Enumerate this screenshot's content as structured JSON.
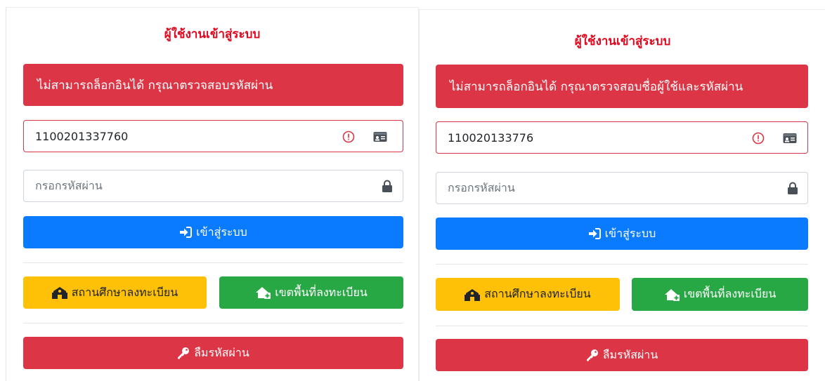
{
  "panels": [
    {
      "title": "ผู้ใช้งานเข้าสู่ระบบ",
      "alert": "ไม่สามารถล็อกอินได้ กรุณาตรวจสอบรหัสผ่าน",
      "username_value": "1100201337760",
      "password_placeholder": "กรอกรหัสผ่าน",
      "login_label": "เข้าสู่ระบบ",
      "school_label": "สถานศึกษาลงทะเบียน",
      "area_label": "เขตพื้นที่ลงทะเบียน",
      "forgot_label": "ลืมรหัสผ่าน"
    },
    {
      "title": "ผู้ใช้งานเข้าสู่ระบบ",
      "alert": "ไม่สามารถล็อกอินได้ กรุณาตรวจสอบชื่อผู้ใช้และรหัสผ่าน",
      "username_value": "110020133776",
      "password_placeholder": "กรอกรหัสผ่าน",
      "login_label": "เข้าสู่ระบบ",
      "school_label": "สถานศึกษาลงทะเบียน",
      "area_label": "เขตพื้นที่ลงทะเบียน",
      "forgot_label": "ลืมรหัสผ่าน"
    }
  ],
  "icons": {
    "invalid": "exclamation-circle-icon",
    "username": "id-card-icon",
    "password": "lock-icon",
    "login": "sign-in-icon",
    "school": "school-icon",
    "area": "house-plus-icon",
    "forgot": "key-icon"
  },
  "colors": {
    "title": "#e3061c",
    "alert": "#dc3545",
    "primary": "#0a7bff",
    "warning": "#ffc107",
    "success": "#28a745",
    "danger": "#dc3545"
  }
}
